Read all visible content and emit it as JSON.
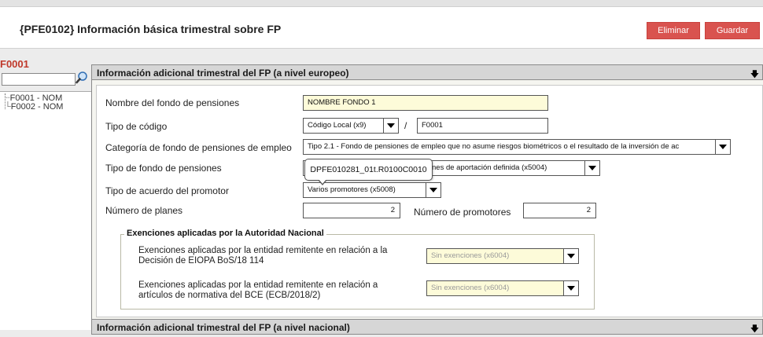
{
  "header": {
    "title": "{PFE0102} Información básica trimestral sobre FP",
    "delete_label": "Eliminar",
    "save_label": "Guardar"
  },
  "sidebar": {
    "code": "F0001",
    "search_value": "",
    "tree": [
      {
        "label": "F0001 - NOM"
      },
      {
        "label": "F0002 - NOM"
      }
    ]
  },
  "section_eu": {
    "title": "Información adicional trimestral del FP (a nivel europeo)",
    "fields": {
      "fund_name_label": "Nombre del fondo de pensiones",
      "fund_name_value": "NOMBRE FONDO 1",
      "code_type_label": "Tipo de código",
      "code_type_value": "Código Local (x9)",
      "slash": "/",
      "code_value": "F0001",
      "category_label": "Categoría de fondo de pensiones de empleo",
      "category_value": "Tipo 2.1 - Fondo de pensiones de empleo que no asume riesgos biométricos o el resultado de la inversión de ac",
      "fund_type_label": "Tipo de fondo de pensiones",
      "fund_type_value": "nes de aportación definida (x5004)",
      "agreement_label": "Tipo de acuerdo del promotor",
      "agreement_value": "Varios promotores (x5008)",
      "plans_label": "Número de planes",
      "plans_value": "2",
      "promoters_label": "Número de promotores",
      "promoters_value": "2"
    },
    "exemptions": {
      "legend": "Exenciones aplicadas por la Autoridad Nacional",
      "row1_label_1": "Exenciones aplicadas por la entidad remitente en relación a la",
      "row1_label_2": "Decisión de EIOPA BoS/18 114",
      "row1_value": "Sin exenciones (x6004)",
      "row2_label_1": "Exenciones aplicadas por la entidad remitente en relación a",
      "row2_label_2": "artículos de normativa del BCE (ECB/2018/2)",
      "row2_value": "Sin exenciones (x6004)"
    },
    "tooltip": "DPFE010281_01t.R0100C0010"
  },
  "section_nat": {
    "title": "Información adicional trimestral del FP (a nivel nacional)"
  },
  "colors": {
    "accent_button": "#d9534f",
    "code_red": "#c0392b",
    "field_yellow": "#fdfbd9"
  },
  "icons": {
    "search": "magnifier-icon",
    "collapse": "collapse-arrow-icon",
    "dropdown": "chevron-down-icon"
  }
}
